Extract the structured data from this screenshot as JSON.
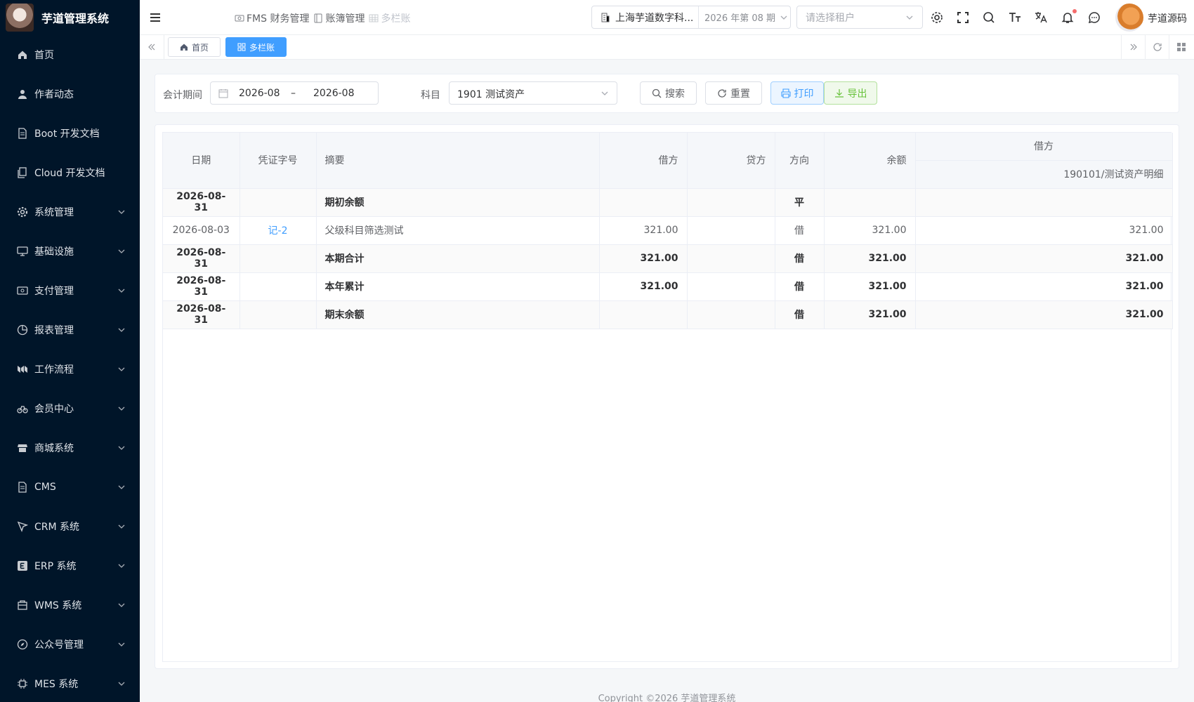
{
  "app": {
    "title": "芋道管理系统"
  },
  "sidebar": {
    "items": [
      {
        "label": "首页",
        "icon": "home-icon",
        "has_children": false
      },
      {
        "label": "作者动态",
        "icon": "user-icon",
        "has_children": false
      },
      {
        "label": "Boot 开发文档",
        "icon": "document-icon",
        "has_children": false
      },
      {
        "label": "Cloud 开发文档",
        "icon": "documents-icon",
        "has_children": false
      },
      {
        "label": "系统管理",
        "icon": "gear-icon",
        "has_children": true
      },
      {
        "label": "基础设施",
        "icon": "monitor-icon",
        "has_children": true
      },
      {
        "label": "支付管理",
        "icon": "payment-icon",
        "has_children": true
      },
      {
        "label": "报表管理",
        "icon": "pie-chart-icon",
        "has_children": true
      },
      {
        "label": "工作流程",
        "icon": "workflow-icon",
        "has_children": true
      },
      {
        "label": "会员中心",
        "icon": "bicycle-icon",
        "has_children": true
      },
      {
        "label": "商城系统",
        "icon": "shop-icon",
        "has_children": true
      },
      {
        "label": "CMS",
        "icon": "document-icon",
        "has_children": true
      },
      {
        "label": "CRM 系统",
        "icon": "crm-icon",
        "has_children": true
      },
      {
        "label": "ERP 系统",
        "icon": "erp-icon",
        "has_children": true
      },
      {
        "label": "WMS 系统",
        "icon": "warehouse-icon",
        "has_children": true
      },
      {
        "label": "公众号管理",
        "icon": "compass-icon",
        "has_children": true
      },
      {
        "label": "MES 系统",
        "icon": "chip-icon",
        "has_children": true
      }
    ]
  },
  "header": {
    "breadcrumb": [
      {
        "label": "FMS 财务管理",
        "icon": "finance-icon"
      },
      {
        "label": "账簿管理",
        "icon": "book-icon"
      },
      {
        "label": "多栏账",
        "icon": "table-icon"
      }
    ],
    "company": "上海芋道数字科...",
    "period": "2026 年第 08 期",
    "tenant_placeholder": "请选择租户",
    "username": "芋道源码"
  },
  "tabs": [
    {
      "label": "首页",
      "icon": "home-icon",
      "active": false
    },
    {
      "label": "多栏账",
      "icon": "grid-icon",
      "active": true
    }
  ],
  "search": {
    "period_label": "会计期间",
    "period_start": "2026-08",
    "period_sep": "–",
    "period_end": "2026-08",
    "subject_label": "科目",
    "subject_value": "1901 测试资产",
    "search_button": "搜索",
    "reset_button": "重置",
    "print_button": "打印",
    "export_button": "导出"
  },
  "table": {
    "headers": {
      "date": "日期",
      "voucher": "凭证字号",
      "summary": "摘要",
      "debit": "借方",
      "credit": "贷方",
      "direction": "方向",
      "balance": "余额",
      "group_debit": "借方",
      "sub_account": "190101/测试资产明细"
    },
    "rows": [
      {
        "date": "2026-08-31",
        "voucher": "",
        "summary": "期初余额",
        "debit": "",
        "credit": "",
        "direction": "平",
        "balance": "",
        "sub": "",
        "bold": true
      },
      {
        "date": "2026-08-03",
        "voucher": "记-2",
        "summary": "父级科目筛选测试",
        "debit": "321.00",
        "credit": "",
        "direction": "借",
        "balance": "321.00",
        "sub": "321.00",
        "bold": false
      },
      {
        "date": "2026-08-31",
        "voucher": "",
        "summary": "本期合计",
        "debit": "321.00",
        "credit": "",
        "direction": "借",
        "balance": "321.00",
        "sub": "321.00",
        "bold": true
      },
      {
        "date": "2026-08-31",
        "voucher": "",
        "summary": "本年累计",
        "debit": "321.00",
        "credit": "",
        "direction": "借",
        "balance": "321.00",
        "sub": "321.00",
        "bold": true
      },
      {
        "date": "2026-08-31",
        "voucher": "",
        "summary": "期末余额",
        "debit": "",
        "credit": "",
        "direction": "借",
        "balance": "321.00",
        "sub": "321.00",
        "bold": true
      }
    ]
  },
  "footer": {
    "copyright": "Copyright ©2026 芋道管理系统"
  },
  "colors": {
    "sidebar_bg": "#001529",
    "primary": "#409eff",
    "success": "#67c23a"
  }
}
